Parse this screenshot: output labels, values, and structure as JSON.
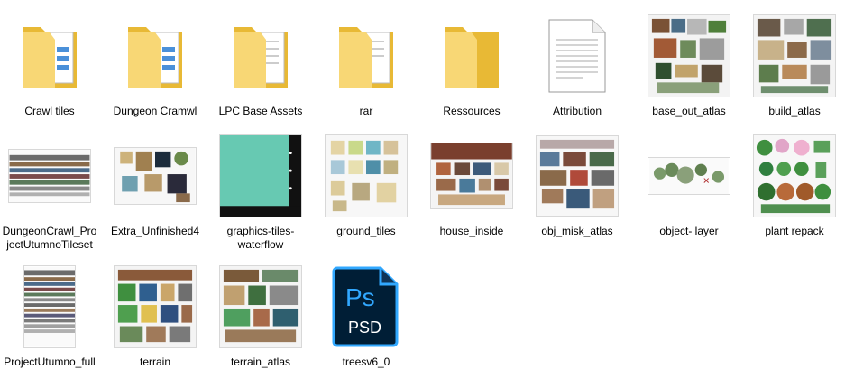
{
  "items": [
    {
      "label": "Crawl tiles",
      "kind": "folder",
      "variant": "docs"
    },
    {
      "label": "Dungeon Cramwl",
      "kind": "folder",
      "variant": "docs"
    },
    {
      "label": "LPC Base Assets",
      "kind": "folder",
      "variant": "papers"
    },
    {
      "label": "rar",
      "kind": "folder",
      "variant": "papers"
    },
    {
      "label": "Ressources",
      "kind": "folder",
      "variant": "empty"
    },
    {
      "label": "Attribution",
      "kind": "text-document"
    },
    {
      "label": "base_out_atlas",
      "kind": "image"
    },
    {
      "label": "build_atlas",
      "kind": "image"
    },
    {
      "label": "DungeonCrawl_ProjectUtumnoTileset",
      "kind": "image"
    },
    {
      "label": "Extra_Unfinished4",
      "kind": "image"
    },
    {
      "label": "graphics-tiles-waterflow",
      "kind": "image"
    },
    {
      "label": "ground_tiles",
      "kind": "image"
    },
    {
      "label": "house_inside",
      "kind": "image"
    },
    {
      "label": "obj_misk_atlas",
      "kind": "image"
    },
    {
      "label": "object- layer",
      "kind": "image"
    },
    {
      "label": "plant repack",
      "kind": "image"
    },
    {
      "label": "ProjectUtumno_full",
      "kind": "image"
    },
    {
      "label": "terrain",
      "kind": "image"
    },
    {
      "label": "terrain_atlas",
      "kind": "image"
    },
    {
      "label": "treesv6_0",
      "kind": "psd",
      "badge": "PSD",
      "logo": "Ps"
    }
  ],
  "colors": {
    "folder_back": "#e8b935",
    "folder_front": "#f8d775",
    "psd_bg": "#001e36",
    "psd_accent": "#31a8ff"
  }
}
